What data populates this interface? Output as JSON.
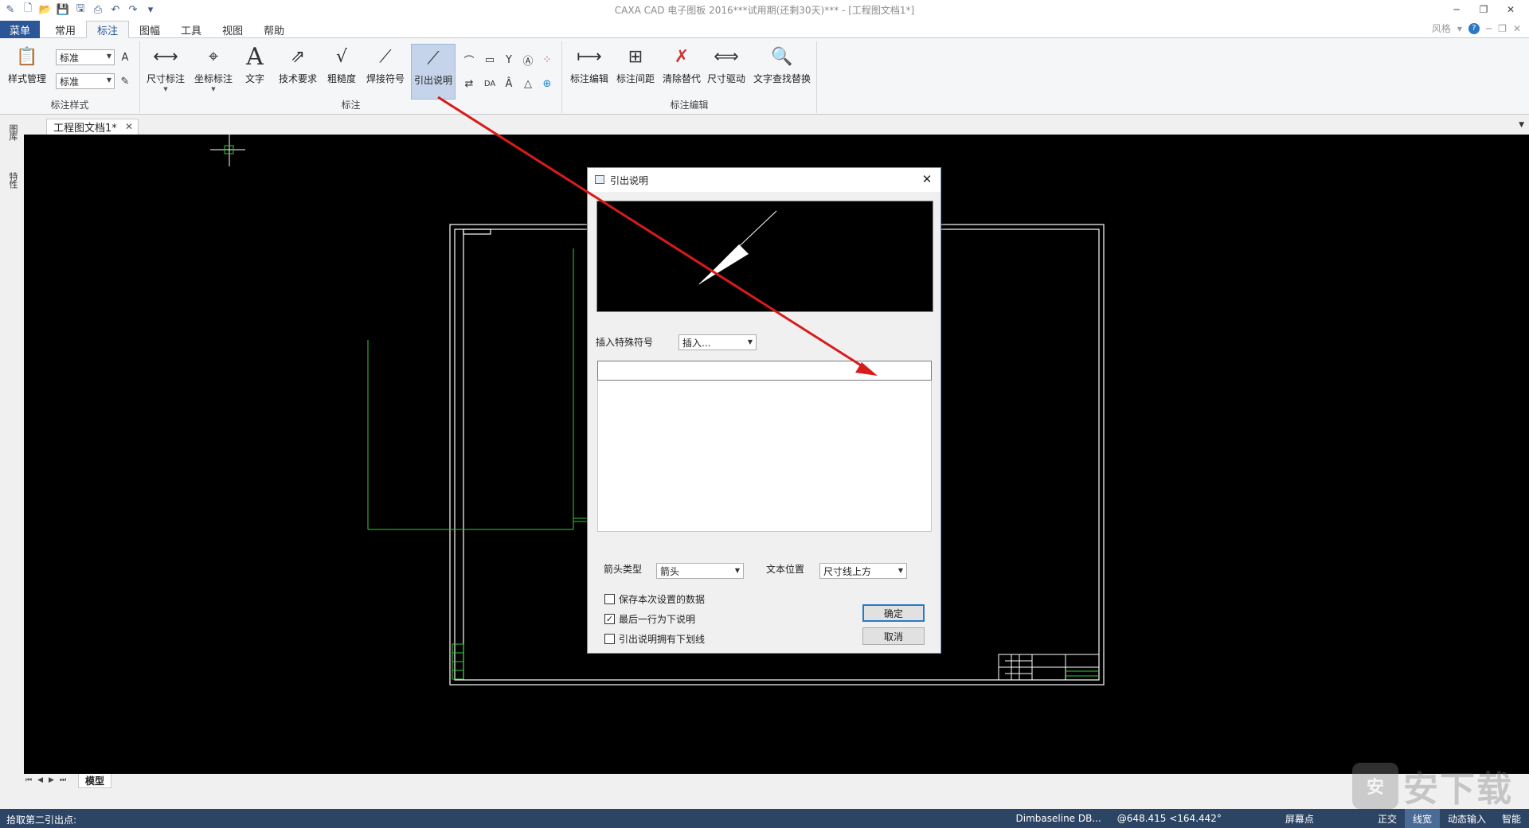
{
  "titlebar": {
    "title": "CAXA CAD 电子图板 2016***试用期(还剩30天)*** - [工程图文档1*]",
    "qat_icons": [
      "app-icon",
      "new-icon",
      "open-icon",
      "save-icon",
      "save-as-icon",
      "print-icon",
      "undo-icon",
      "redo-icon",
      "customize-icon"
    ]
  },
  "tabs": {
    "menu": "菜单",
    "items": [
      "常用",
      "标注",
      "图幅",
      "工具",
      "视图",
      "帮助"
    ],
    "active": "标注",
    "style_label": "风格"
  },
  "ribbon": {
    "group_style": {
      "label": "标注样式",
      "style_manager": "样式管理",
      "combo1": "标准",
      "combo2": "标准"
    },
    "group_annotate": {
      "label": "标注",
      "buttons": [
        "尺寸标注",
        "坐标标注",
        "文字",
        "技术要求",
        "粗糙度",
        "焊接符号",
        "引出说明"
      ]
    },
    "group_edit": {
      "label": "标注编辑",
      "buttons": [
        "标注编辑",
        "标注间距",
        "清除替代",
        "尺寸驱动",
        "文字查找替换"
      ]
    }
  },
  "document": {
    "tab_title": "工程图文档1*"
  },
  "side_panel": {
    "tabs": [
      "图库",
      "特性"
    ]
  },
  "model_tab": "模型",
  "status": {
    "prompt": "拾取第二引出点:",
    "command": "Dimbaseline DB...",
    "coords": "@648.415 <164.442°",
    "items": [
      "屏幕点",
      "正交",
      "线宽",
      "动态输入",
      "智能"
    ],
    "active": "线宽"
  },
  "dialog": {
    "title": "引出说明",
    "insert_label": "插入特殊符号",
    "insert_value": "插入...",
    "arrow_type_label": "箭头类型",
    "arrow_type_value": "箭头",
    "text_pos_label": "文本位置",
    "text_pos_value": "尺寸线上方",
    "checkbox1": "保存本次设置的数据",
    "checkbox1_checked": false,
    "checkbox2": "最后一行为下说明",
    "checkbox2_checked": true,
    "checkbox3": "引出说明拥有下划线",
    "checkbox3_checked": false,
    "ok": "确定",
    "cancel": "取消"
  },
  "watermark": {
    "badge": "安",
    "text": "安下载"
  },
  "colors": {
    "menu_blue": "#2b5797",
    "status_bg": "#2d4565",
    "annotation_red": "#d81b1b",
    "drawing_green": "#33cc33"
  }
}
